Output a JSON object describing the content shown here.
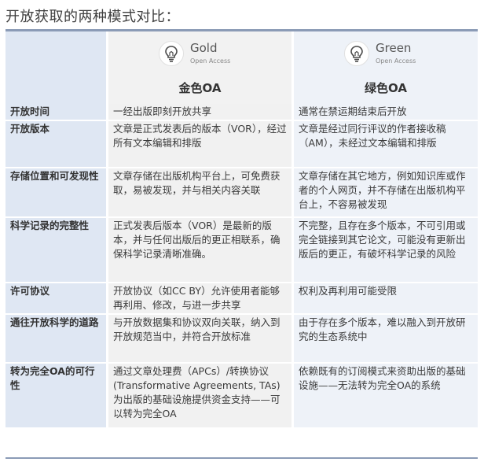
{
  "title": "开放获取的两种模式对比：",
  "columns": [
    {
      "brand": "Gold",
      "sub": "Open Access",
      "heading": "金色OA",
      "icon": "lightbulb-icon"
    },
    {
      "brand": "Green",
      "sub": "Open Access",
      "heading": "绿色OA",
      "icon": "lightbulb-icon"
    }
  ],
  "rows": [
    {
      "label": "开放时间",
      "gold": "一经出版即刻开放共享",
      "green": "通常在禁运期结束后开放"
    },
    {
      "label": "开放版本",
      "gold": "文章是正式发表后的版本（VOR），经过所有文本编辑和排版",
      "green": "文章是经过同行评议的作者接收稿（AM），未经过文本编辑和排版"
    },
    {
      "label": "存储位置和可发现性",
      "gold": "文章存储在出版机构平台上，可免费获取，易被发现，并与相关内容关联",
      "green": "文章存储在其它地方，例如知识库或作者的个人网页，并不存储在出版机构平台上，不容易被发现"
    },
    {
      "label": "科学记录的完整性",
      "gold": "正式发表后版本（VOR）是最新的版本，并与任何出版后的更正相联系，确保科学记录清晰准确。",
      "green": "不完整，且存在多个版本，不可引用或完全链接到其它论文，可能没有更新出版后的更正，有破坏科学记录的风险"
    },
    {
      "label": "许可协议",
      "gold": "开放协议（如CC BY）允许使用者能够再利用、修改，与进一步共享",
      "green": "权利及再利用可能受限"
    },
    {
      "label": "通往开放科学的道路",
      "gold": "与开放数据集和协议双向关联，纳入到开放规范当中，并符合开放标准",
      "green": "由于存在多个版本，难以融入到开放研究的生态系统中"
    },
    {
      "label": "转为完全OA的可行性",
      "gold": "通过文章处理费（APCs）/转换协议(Transformative Agreements, TAs)为出版的基础设施提供资金支持——可以转为完全OA",
      "green": "依赖既有的订阅模式来资助出版的基础设施——无法转为完全OA的系统"
    }
  ],
  "colors": {
    "gold_icon": "#4a4a4a",
    "green_icon": "#4a4a4a",
    "label_bg": "#dfe7f3",
    "rule": "#8b9bb6"
  }
}
